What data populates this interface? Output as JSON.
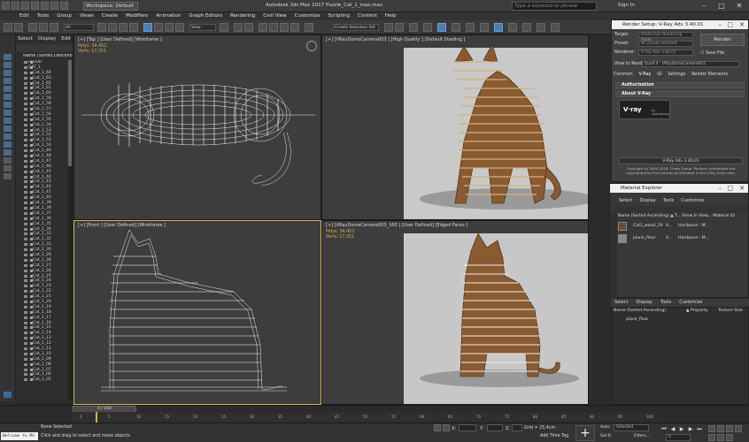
{
  "window": {
    "app_title": "Autodesk 3ds Max 2017",
    "file_title": "Puzzle_Cat_1_max.max",
    "workspace": "Workspace: Default",
    "search_placeholder": "Type a keyword or phrase",
    "sign_in": "Sign In",
    "minimize": "–",
    "maximize": "□",
    "close": "✕"
  },
  "menu": [
    "Edit",
    "Tools",
    "Group",
    "Views",
    "Create",
    "Modifiers",
    "Animation",
    "Graph Editors",
    "Rendering",
    "Civil View",
    "Customize",
    "Scripting",
    "Content",
    "Help"
  ],
  "toolbar": {
    "filter_select": "All",
    "ref_coord": "View",
    "selection_set": "Create Selection Set"
  },
  "scene_explorer": {
    "menu": [
      "Select",
      "Display",
      "Edit"
    ],
    "header": "Name (Sorted Descending)",
    "items": [
      {
        "name": "FLOOR",
        "level": 0
      },
      {
        "name": "CAT_1",
        "level": 0
      },
      {
        "name": "Cat_1_64",
        "level": 1
      },
      {
        "name": "Cat_1_63",
        "level": 1
      },
      {
        "name": "Cat_1_62",
        "level": 1
      },
      {
        "name": "Cat_1_61",
        "level": 1
      },
      {
        "name": "Cat_1_60",
        "level": 1
      },
      {
        "name": "Cat_1_59",
        "level": 1
      },
      {
        "name": "Cat_1_58",
        "level": 1
      },
      {
        "name": "Cat_1_57",
        "level": 1
      },
      {
        "name": "Cat_1_56",
        "level": 1
      },
      {
        "name": "Cat_1_55",
        "level": 1
      },
      {
        "name": "Cat_1_54",
        "level": 1
      },
      {
        "name": "Cat_1_53",
        "level": 1
      },
      {
        "name": "Cat_1_52",
        "level": 1
      },
      {
        "name": "Cat_1_51",
        "level": 1
      },
      {
        "name": "Cat_1_50",
        "level": 1
      },
      {
        "name": "Cat_1_49",
        "level": 1
      },
      {
        "name": "Cat_1_48",
        "level": 1
      },
      {
        "name": "Cat_1_47",
        "level": 1
      },
      {
        "name": "Cat_1_46",
        "level": 1
      },
      {
        "name": "Cat_1_45",
        "level": 1
      },
      {
        "name": "Cat_1_44",
        "level": 1
      },
      {
        "name": "Cat_1_43",
        "level": 1
      },
      {
        "name": "Cat_1_42",
        "level": 1
      },
      {
        "name": "Cat_1_41",
        "level": 1
      },
      {
        "name": "Cat_1_40",
        "level": 1
      },
      {
        "name": "Cat_1_39",
        "level": 1
      },
      {
        "name": "Cat_1_38",
        "level": 1
      },
      {
        "name": "Cat_1_37",
        "level": 1
      },
      {
        "name": "Cat_1_36",
        "level": 1
      },
      {
        "name": "Cat_1_35",
        "level": 1
      },
      {
        "name": "Cat_1_34",
        "level": 1
      },
      {
        "name": "Cat_1_33",
        "level": 1
      },
      {
        "name": "Cat_1_32",
        "level": 1
      },
      {
        "name": "Cat_1_31",
        "level": 1
      },
      {
        "name": "Cat_1_30",
        "level": 1
      },
      {
        "name": "Cat_1_29",
        "level": 1
      },
      {
        "name": "Cat_1_28",
        "level": 1
      },
      {
        "name": "Cat_1_27",
        "level": 1
      },
      {
        "name": "Cat_1_26",
        "level": 1
      },
      {
        "name": "Cat_1_25",
        "level": 1
      },
      {
        "name": "Cat_1_24",
        "level": 1
      },
      {
        "name": "Cat_1_23",
        "level": 1
      },
      {
        "name": "Cat_1_22",
        "level": 1
      },
      {
        "name": "Cat_1_21",
        "level": 1
      },
      {
        "name": "Cat_1_20",
        "level": 1
      },
      {
        "name": "Cat_1_19",
        "level": 1
      },
      {
        "name": "Cat_1_18",
        "level": 1
      },
      {
        "name": "Cat_1_17",
        "level": 1
      },
      {
        "name": "Cat_1_16",
        "level": 1
      },
      {
        "name": "Cat_1_15",
        "level": 1
      },
      {
        "name": "Cat_1_14",
        "level": 1
      },
      {
        "name": "Cat_1_13",
        "level": 1
      },
      {
        "name": "Cat_1_12",
        "level": 1
      },
      {
        "name": "Cat_1_11",
        "level": 1
      },
      {
        "name": "Cat_1_10",
        "level": 1
      },
      {
        "name": "Cat_1_09",
        "level": 1
      },
      {
        "name": "Cat_1_08",
        "level": 1
      },
      {
        "name": "Cat_1_07",
        "level": 1
      },
      {
        "name": "Cat_1_06",
        "level": 1
      },
      {
        "name": "Cat_1_05",
        "level": 1
      }
    ]
  },
  "viewports": {
    "top_left": {
      "label": "[+] [Top ] [User Defined] [Wireframe ]",
      "polys_label": "Polys:",
      "polys": "34,452",
      "verts_label": "Verts:",
      "verts": "17,351"
    },
    "top_right": {
      "label": "[+] [VRayDomeCamera003 ] [High Quality ] [Default Shading ]"
    },
    "bottom_left": {
      "label": "[+] [Front ] [User Defined] [Wireframe ]"
    },
    "bottom_right": {
      "label": "[+] [VRayDomeCamera003_160 ] [User Defined] [Edged Faces ]",
      "polys_label": "Polys:",
      "polys": "34,452",
      "verts_label": "Verts:",
      "verts": "17,351"
    }
  },
  "render_setup": {
    "title": "Render Setup: V-Ray Adv 3.40.01",
    "target_label": "Target:",
    "target": "Production Rendering Mode",
    "preset_label": "Preset:",
    "preset": "No preset selected",
    "renderer_label": "Renderer:",
    "renderer": "V-Ray Adv 3.40.01",
    "render_button": "Render",
    "save_file": "Save File",
    "view_to_render_label": "View to Render:",
    "view_to_render": "Quad 4 - VRayDomeCamera003",
    "tabs": [
      "Common",
      "V-Ray",
      "GI",
      "Settings",
      "Render Elements"
    ],
    "rollouts": [
      "Authorization",
      "About V-Ray"
    ],
    "logo_text": "V·ray",
    "logo_sub": "by chaosgroup",
    "version": "V-Ray Adv 3.40.01",
    "copyright": "Copyright (c) 2000-2016, Chaos Group. Portions contributed and copyrighted by third parties as indicated in the V-Ray help index."
  },
  "material_explorer": {
    "title": "Material Explorer",
    "menu": [
      "Select",
      "Display",
      "Tools",
      "Customize"
    ],
    "header": "Name (Sorted Ascending)  ▲  T... Show In View... Material ID",
    "rows": [
      {
        "name": "Cat1_wood_19",
        "type": "V...",
        "show": "Hardware : M..."
      },
      {
        "name": "plane_floor",
        "type": "V...",
        "show": "Hardware : M..."
      }
    ],
    "bottom_menu": [
      "Select",
      "Display",
      "Tools",
      "Customize"
    ],
    "bottom_header_name": "Name (Sorted Ascending)",
    "bottom_header_property": "▲ Property",
    "bottom_header_texture": "Texture Size",
    "bottom_item": "plane_floor"
  },
  "timeline": {
    "slider": "0 / 100",
    "ticks": [
      "0",
      "5",
      "10",
      "15",
      "20",
      "25",
      "30",
      "35",
      "40",
      "45",
      "50",
      "55",
      "60",
      "65",
      "70",
      "75",
      "80",
      "85",
      "90",
      "95",
      "100"
    ]
  },
  "status": {
    "maxscript": "Welcome to MA",
    "selection": "None Selected",
    "hint": "Click and drag to select and move objects",
    "x_label": "X:",
    "y_label": "Y:",
    "z_label": "Z:",
    "grid": "Grid = 25,4cm",
    "add_time_tag": "Add Time Tag",
    "auto": "Auto",
    "selected": "Selected",
    "set_k": "Set K.",
    "filters": "Filters...",
    "frame": "0"
  },
  "colors": {
    "accent": "#4a7fb0",
    "stats_yellow": "#d6b24a",
    "wood": "#8a5a30",
    "viewport_bg": "#3d3d3d"
  }
}
